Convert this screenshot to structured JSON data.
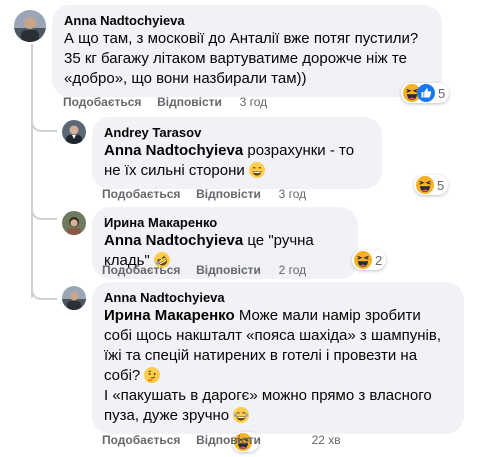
{
  "actions": {
    "like": "Подобається",
    "reply": "Відповісти"
  },
  "comments": [
    {
      "author": "Anna Nadtochyieva",
      "text": "А що там, з московії до Анталії вже потяг пустили? 35 кг багажу літаком вартуватиме дорожче ніж те «добро», що вони назбирали там))",
      "time": "3 год",
      "reactions": {
        "count": "5",
        "icons": [
          "haha-icon",
          "like-icon"
        ]
      }
    },
    {
      "author": "Andrey Tarasov",
      "mention": "Anna Nadtochyieva",
      "text": " розрахунки - то не їх сильні сторони ",
      "emoji": "grin-emoji",
      "time": "3 год",
      "reactions": {
        "count": "5",
        "icons": [
          "haha-icon"
        ]
      }
    },
    {
      "author": "Ирина Макаренко",
      "mention": "Anna Nadtochyieva",
      "text": " це \"ручна кладь\" ",
      "emoji": "rofl-emoji",
      "time": "2 год",
      "reactions": {
        "count": "2",
        "icons": [
          "haha-icon"
        ]
      }
    },
    {
      "author": "Anna Nadtochyieva",
      "mention": "Ирина Макаренко",
      "text": " Може мали намір зробити собі щось накшталт «пояса шахіда» з шампунів, їжі та спецій натирених в готелі і провезти на собі? ",
      "emoji": "thinking-emoji",
      "text2": "І «пакушать в дарогє» можно прямо з власного пуза, дуже зручно ",
      "emoji2": "laugh-emoji",
      "time": "22 хв",
      "reactions": {
        "count": "",
        "icons": [
          "haha-icon"
        ]
      }
    }
  ],
  "colors": {
    "bubble": "#f0f2f5",
    "meta": "#65676b",
    "haha": "#f7b125",
    "like": "#1877f2"
  }
}
